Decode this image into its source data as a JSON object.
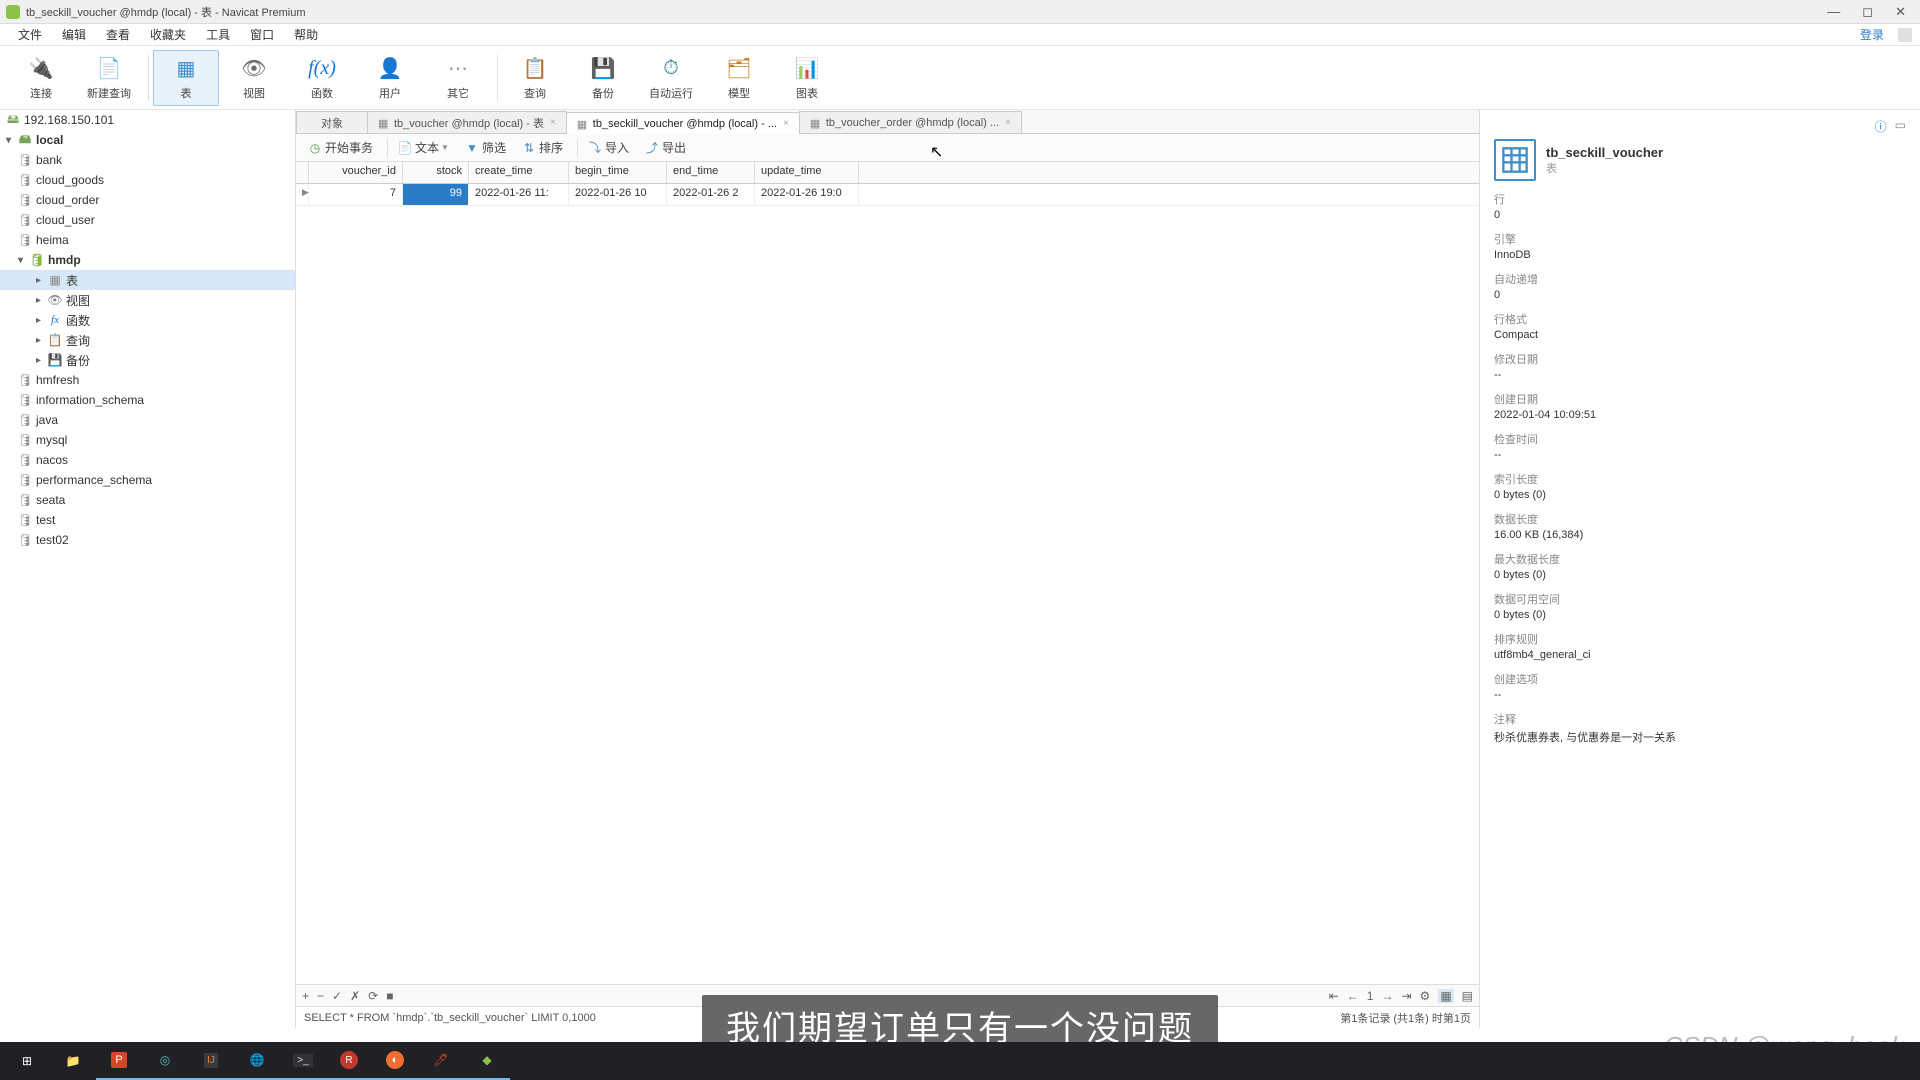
{
  "window": {
    "title": "tb_seckill_voucher @hmdp (local) - 表 - Navicat Premium"
  },
  "menu": [
    "文件",
    "编辑",
    "查看",
    "收藏夹",
    "工具",
    "窗口",
    "帮助"
  ],
  "login": "登录",
  "toolbar": [
    {
      "label": "连接",
      "icon": "link-icon"
    },
    {
      "label": "新建查询",
      "icon": "new-query-icon"
    },
    {
      "label": "表",
      "icon": "table-icon",
      "active": true
    },
    {
      "label": "视图",
      "icon": "view-icon"
    },
    {
      "label": "f(x) 函数",
      "icon": "fn-icon"
    },
    {
      "label": "用户",
      "icon": "user-icon"
    },
    {
      "label": "其它",
      "icon": "other-icon"
    },
    {
      "label": "查询",
      "icon": "query-icon"
    },
    {
      "label": "备份",
      "icon": "backup-icon"
    },
    {
      "label": "自动运行",
      "icon": "auto-icon"
    },
    {
      "label": "模型",
      "icon": "model-icon"
    },
    {
      "label": "图表",
      "icon": "chart-icon"
    }
  ],
  "tree": {
    "connection": "192.168.150.101",
    "local": "local",
    "dbs": [
      "bank",
      "cloud_goods",
      "cloud_order",
      "cloud_user",
      "heima",
      "hmdp",
      "hmfresh",
      "information_schema",
      "java",
      "mysql",
      "nacos",
      "performance_schema",
      "seata",
      "test",
      "test02"
    ],
    "hmdp_children": [
      "表",
      "视图",
      "函数",
      "查询",
      "备份"
    ]
  },
  "tabs": [
    {
      "label": "对象",
      "active": false
    },
    {
      "label": "tb_voucher @hmdp (local) - 表",
      "active": false
    },
    {
      "label": "tb_seckill_voucher @hmdp (local) - ...",
      "active": true
    },
    {
      "label": "tb_voucher_order @hmdp (local) ...",
      "active": false
    }
  ],
  "subToolbar": [
    "开始事务",
    "文本",
    "筛选",
    "排序",
    "导入",
    "导出"
  ],
  "grid": {
    "columns": [
      "voucher_id",
      "stock",
      "create_time",
      "begin_time",
      "end_time",
      "update_time"
    ],
    "row": {
      "voucher_id": "7",
      "stock": "99",
      "create_time": "2022-01-26 11:",
      "begin_time": "2022-01-26 10",
      "end_time": "2022-01-26 2",
      "update_time": "2022-01-26 19:0"
    }
  },
  "sql": "SELECT * FROM `hmdp`.`tb_seckill_voucher` LIMIT 0,1000",
  "statusRight": "第1条记录 (共1条)  时第1页",
  "rightPanel": {
    "title": "tb_seckill_voucher",
    "subtitle": "表",
    "props": [
      {
        "label": "行",
        "value": "0"
      },
      {
        "label": "引擎",
        "value": "InnoDB"
      },
      {
        "label": "自动递增",
        "value": "0"
      },
      {
        "label": "行格式",
        "value": "Compact"
      },
      {
        "label": "修改日期",
        "value": "--"
      },
      {
        "label": "创建日期",
        "value": "2022-01-04 10:09:51"
      },
      {
        "label": "检查时间",
        "value": "--"
      },
      {
        "label": "索引长度",
        "value": "0 bytes (0)"
      },
      {
        "label": "数据长度",
        "value": "16.00 KB (16,384)"
      },
      {
        "label": "最大数据长度",
        "value": "0 bytes (0)"
      },
      {
        "label": "数据可用空间",
        "value": "0 bytes (0)"
      },
      {
        "label": "排序规则",
        "value": "utf8mb4_general_ci"
      },
      {
        "label": "创建选项",
        "value": "--"
      },
      {
        "label": "注释",
        "value": "秒杀优惠券表, 与优惠券是一对一关系"
      }
    ]
  },
  "subtitle": "我们期望订单只有一个没问题",
  "watermark": "CSDN @wang_book"
}
